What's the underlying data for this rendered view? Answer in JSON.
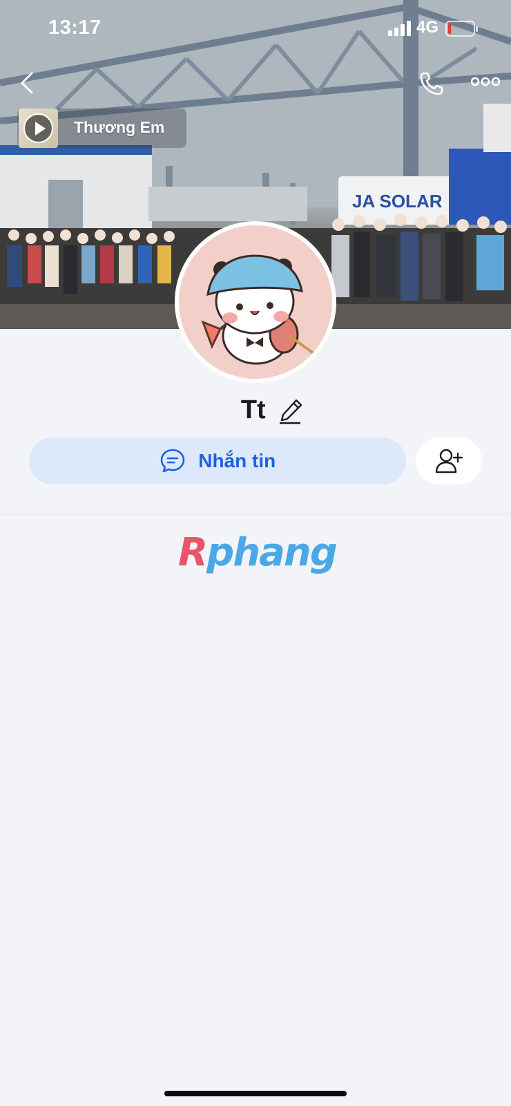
{
  "status_bar": {
    "time": "13:17",
    "network": "4G",
    "battery_level_fraction": 0.12,
    "battery_color": "#e53935"
  },
  "nav": {
    "back_icon": "chevron-left-icon",
    "call_icon": "phone-icon",
    "more_icon": "more-dots-icon"
  },
  "cover": {
    "sign_text": "JA SOLAR"
  },
  "music": {
    "title": "Thương Em",
    "icon": "play-icon"
  },
  "profile": {
    "name": "Tt",
    "edit_icon": "pencil-icon"
  },
  "actions": {
    "message_label": "Nhắn tin",
    "message_icon": "chat-bubble-icon",
    "add_friend_icon": "add-friend-icon",
    "accent_color": "#1c62e1"
  },
  "watermark": {
    "text_first": "R",
    "text_rest": "phang"
  }
}
